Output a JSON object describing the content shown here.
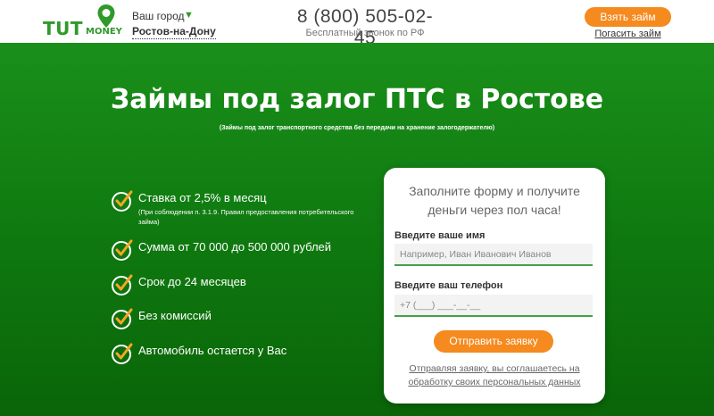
{
  "header": {
    "logo_tut": "TUT",
    "logo_money": "MONEY",
    "city_label": "Ваш город",
    "city_value": "Ростов-на-Дону",
    "phone": "8 (800) 505-02-45",
    "phone_note": "Бесплатный звонок по РФ",
    "cta_button": "Взять займ",
    "repay_link": "Погасить займ"
  },
  "hero": {
    "title": "Займы под залог ПТС в Ростове",
    "subtitle": "(Займы под залог транспортного средства без передачи на хранение залогодержателю)"
  },
  "features": [
    {
      "text": "Ставка от 2,5% в месяц",
      "note": "(При соблюдении п. 3.1.9. Правил предоставления потребительского займа)"
    },
    {
      "text": "Сумма от 70 000 до 500 000 рублей"
    },
    {
      "text": "Срок до 24 месяцев"
    },
    {
      "text": "Без комиссий"
    },
    {
      "text": "Автомобиль остается у Вас"
    }
  ],
  "form": {
    "title_line1": "Заполните форму и получите",
    "title_line2": "деньги через пол часа!",
    "name_label": "Введите ваше имя",
    "name_placeholder": "Например, Иван Иванович Иванов",
    "phone_label": "Введите ваш телефон",
    "phone_placeholder": "+7 (___) ___-__-__",
    "submit": "Отправить заявку",
    "agree": "Отправляя заявку, вы соглашаетесь на обработку своих персональных данных"
  },
  "colors": {
    "brand_green": "#2f9a2a",
    "accent_orange": "#f58a1f",
    "hero_green": "#0f7a10"
  }
}
